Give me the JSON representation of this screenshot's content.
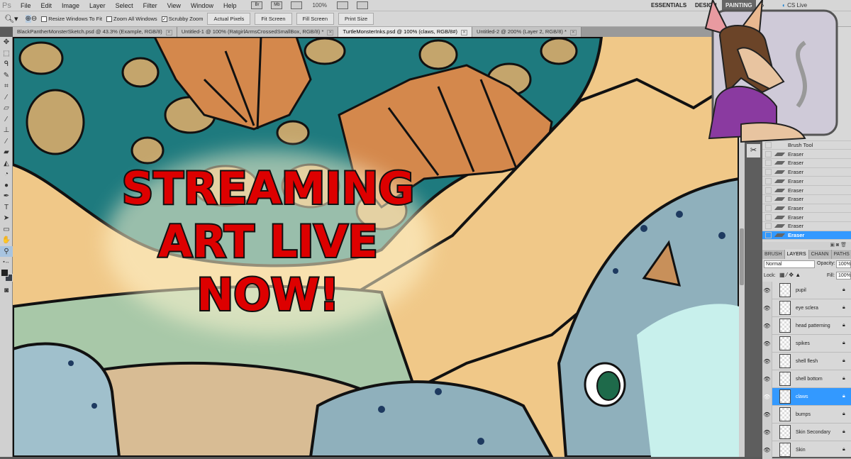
{
  "app": {
    "logo": "Ps"
  },
  "menu": [
    "File",
    "Edit",
    "Image",
    "Layer",
    "Select",
    "Filter",
    "View",
    "Window",
    "Help"
  ],
  "appbar": {
    "bridge": "Br",
    "minibridge": "Mb",
    "zoom": "100%"
  },
  "workspaces": {
    "essentials": "ESSENTIALS",
    "design": "DESIGN",
    "painting": "PAINTING",
    "more": "»",
    "cslive": "CS Live"
  },
  "options": {
    "resize_windows": "Resize Windows To Fit",
    "zoom_all": "Zoom All Windows",
    "scrubby": "Scrubby Zoom",
    "actual_pixels": "Actual Pixels",
    "fit_screen": "Fit Screen",
    "fill_screen": "Fill Screen",
    "print_size": "Print Size"
  },
  "tabs": [
    "BlackPantherMonsterSketch.psd @ 43.3% (Example, RGB/8)",
    "Untitled-1 @ 100% (RatgirlArmsCrossedSmallBox, RGB/8) *",
    "TurtleMonsterInks.psd @ 100% (claws, RGB/8#)",
    "Untitled-2 @ 200% (Layer 2, RGB/8) *"
  ],
  "history": [
    "Eraser",
    "Brush Tool",
    "Eraser",
    "Eraser",
    "Eraser",
    "Eraser",
    "Eraser",
    "Eraser",
    "Eraser",
    "Eraser",
    "Eraser",
    "Eraser"
  ],
  "panel_tabs": [
    "BRUSH",
    "LAYERS",
    "CHANN",
    "PATHS"
  ],
  "layers_panel": {
    "blend_mode": "Normal",
    "opacity_label": "Opacity:",
    "opacity": "100%",
    "lock_label": "Lock:",
    "fill_label": "Fill:",
    "fill": "100%"
  },
  "layers": [
    "pupil",
    "eye sclera",
    "head patterning",
    "spikes",
    "shell flesh",
    "shell bottom",
    "claws",
    "bumps",
    "Skin Secondary",
    "Skin"
  ],
  "selected_layer": "claws",
  "overlay_text": {
    "line1": "STREAMING",
    "line2": "ART LIVE",
    "line3": "NOW!"
  },
  "colors": {
    "accent": "#3399ff",
    "text_red": "#dd0000",
    "teal": "#1e7a7e",
    "orange": "#d4884c",
    "cream": "#f0c888",
    "turtle": "#8fb0bc"
  }
}
